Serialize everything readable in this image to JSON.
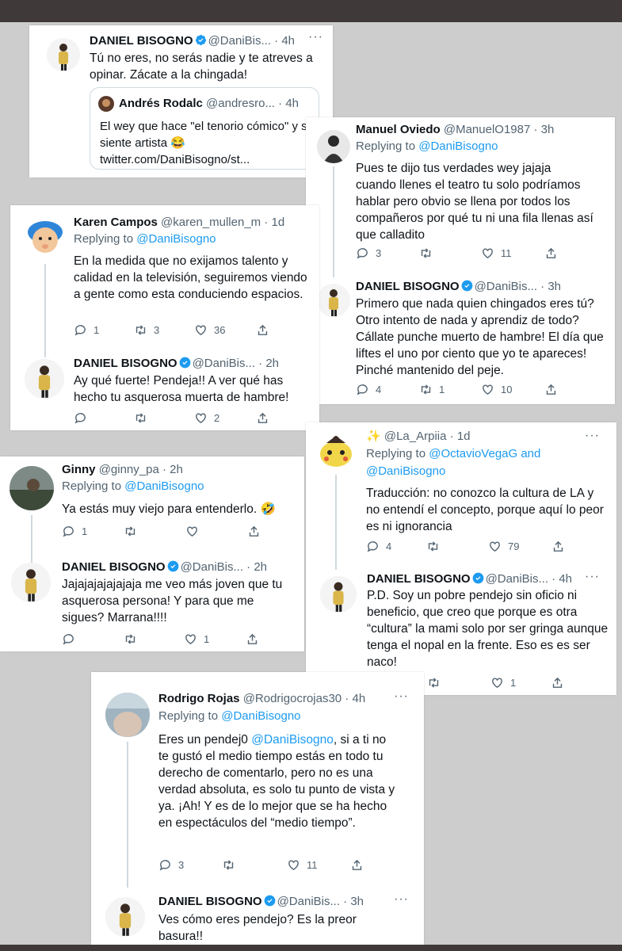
{
  "tweets": {
    "t1": {
      "name": "DANIEL BISOGNO",
      "handle": "@DaniBis...",
      "time": "4h",
      "body": "Tú no eres, no serás nadie y te atreves a opinar. Zácate a la chingada!",
      "quote": {
        "name": "Andrés Rodalc",
        "handle": "@andresro...",
        "time": "4h",
        "body_a": "El wey que hace \"el tenorio cómico\" y se siente artista ",
        "emoji": "😂",
        "body_b": " twitter.com/DaniBisogno/st..."
      }
    },
    "t2": {
      "name": "Manuel Oviedo",
      "handle": "@ManuelO1987",
      "time": "3h",
      "replying": "Replying to",
      "reply_to": "@DaniBisogno",
      "body": "Pues te dijo tus verdades wey jajaja cuando llenes el teatro tu solo podríamos hablar pero obvio se llena por todos los compañeros por qué tu ni una fila llenas así que calladito",
      "replies": "3",
      "retweets": "",
      "likes": "11"
    },
    "t3": {
      "name": "DANIEL BISOGNO",
      "handle": "@DaniBis...",
      "time": "3h",
      "body": "Primero que nada quien chingados eres tú? Otro intento de nada y aprendiz de todo? Cállate punche muerto de hambre! El día que liftes el uno por ciento que yo te apareces! Pinché mantenido del peje.",
      "replies": "4",
      "retweets": "1",
      "likes": "10"
    },
    "t4": {
      "name": "Karen Campos",
      "handle": "@karen_mullen_m",
      "time": "1d",
      "replying": "Replying to",
      "reply_to": "@DaniBisogno",
      "body": "En la medida que no exijamos talento y calidad en la televisión, seguiremos viendo a gente como esta conduciendo espacios.",
      "replies": "1",
      "retweets": "3",
      "likes": "36"
    },
    "t5": {
      "name": "DANIEL BISOGNO",
      "handle": "@DaniBis...",
      "time": "2h",
      "body": "Ay qué fuerte! Pendeja!! A ver qué has hecho tu asquerosa muerta de hambre!",
      "replies": "",
      "retweets": "",
      "likes": "2"
    },
    "t6": {
      "name": "Ginny",
      "handle": "@ginny_pa",
      "time": "2h",
      "replying": "Replying to",
      "reply_to": "@DaniBisogno",
      "body": "Ya estás muy viejo para entenderlo. ",
      "emoji": "🤣",
      "replies": "1",
      "retweets": "",
      "likes": ""
    },
    "t7": {
      "name": "DANIEL BISOGNO",
      "handle": "@DaniBis...",
      "time": "2h",
      "body": "Jajajajajajajaja me veo más joven que tu asquerosa persona! Y para que me sigues? Marrana!!!!",
      "replies": "",
      "retweets": "",
      "likes": "1"
    },
    "t8": {
      "name": "",
      "sparkle": "✨",
      "handle": "@La_Arpiia",
      "time": "1d",
      "replying": "Replying to",
      "reply_to": "@OctavioVegaG and",
      "reply_to_2": "@DaniBisogno",
      "body": "Traducción: no conozco la cultura de LA y no entendí el concepto, porque aquí lo peor es ni ignorancia",
      "replies": "4",
      "retweets": "",
      "likes": "79"
    },
    "t9": {
      "name": "DANIEL BISOGNO",
      "handle": "@DaniBis...",
      "time": "4h",
      "body": "P.D. Soy un pobre pendejo  sin oficio ni beneficio, que creo que porque es otra “cultura” la mami solo por ser gringa aunque tenga el nopal en la frente. Eso es es ser naco!",
      "replies": "",
      "retweets": "",
      "likes": "1"
    },
    "t10": {
      "name": "Rodrigo Rojas",
      "handle": "@Rodrigocrojas30",
      "time": "4h",
      "replying": "Replying to",
      "reply_to": "@DaniBisogno",
      "body_a": "Eres un pendej0 ",
      "body_link": "@DaniBisogno",
      "body_b": ", si a ti no te gustó el medio tiempo estás en todo tu derecho de comentarlo, pero no es una verdad absoluta, es solo tu punto de vista y ya. ¡Ah! Y es de lo mejor que se ha hecho en espectáculos del “medio tiempo”.",
      "replies": "3",
      "retweets": "",
      "likes": "11"
    },
    "t11": {
      "name": "DANIEL BISOGNO",
      "handle": "@DaniBis...",
      "time": "3h",
      "body": "Ves cómo eres pendejo? Es la preor basura!!"
    }
  },
  "icons": {
    "verified": "verified-badge-icon",
    "more": "more-icon",
    "reply": "reply-icon",
    "retweet": "retweet-icon",
    "like": "like-icon",
    "share": "share-icon"
  },
  "colors": {
    "link": "#1d9bf0",
    "verified": "#1d9bf0",
    "muted": "#536471"
  }
}
